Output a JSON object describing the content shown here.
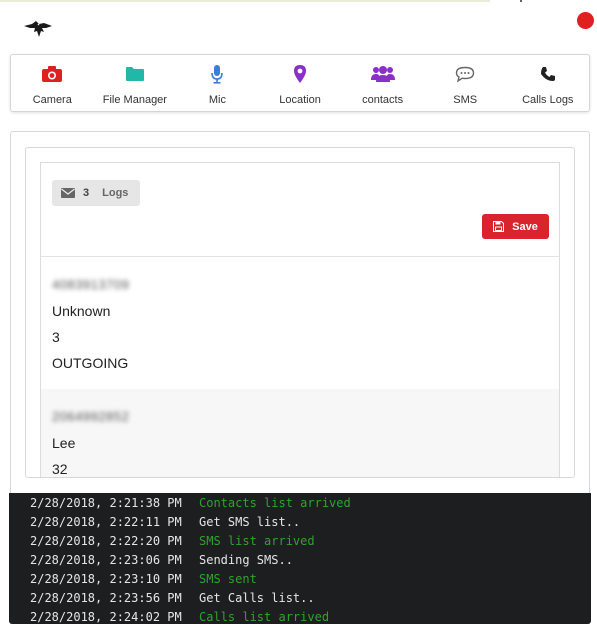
{
  "colors": {
    "accent": "#d9232d",
    "status_dot": "#e02020",
    "camera": "#e02020",
    "file_manager": "#21b8a7",
    "mic": "#3b7dd8",
    "location": "#8b2fc9",
    "contacts": "#8b2fc9",
    "sms": "#666666",
    "calls": "#222222",
    "console_bg": "#1d1e20",
    "console_green": "#32a22e"
  },
  "nav": [
    {
      "label": "Camera",
      "icon": "camera-icon"
    },
    {
      "label": "File Manager",
      "icon": "folder-icon"
    },
    {
      "label": "Mic",
      "icon": "microphone-icon"
    },
    {
      "label": "Location",
      "icon": "map-marker-icon"
    },
    {
      "label": "contacts",
      "icon": "users-icon"
    },
    {
      "label": "SMS",
      "icon": "comment-icon"
    },
    {
      "label": "Calls Logs",
      "icon": "phone-icon"
    }
  ],
  "logs": {
    "count": "3",
    "label": "Logs",
    "save_label": "Save",
    "entries": [
      {
        "number": "4083913709",
        "name": "Unknown",
        "duration": "3",
        "type": "OUTGOING"
      },
      {
        "number": "2064992852",
        "name": "Lee",
        "duration": "32",
        "type": ""
      }
    ]
  },
  "console": [
    {
      "time": "2/28/2018, 2:21:38 PM",
      "message": "Contacts list arrived",
      "color": "green"
    },
    {
      "time": "2/28/2018, 2:22:11 PM",
      "message": "Get SMS list..",
      "color": "white"
    },
    {
      "time": "2/28/2018, 2:22:20 PM",
      "message": "SMS list arrived",
      "color": "green"
    },
    {
      "time": "2/28/2018, 2:23:06 PM",
      "message": "Sending SMS..",
      "color": "white"
    },
    {
      "time": "2/28/2018, 2:23:10 PM",
      "message": "SMS sent",
      "color": "green"
    },
    {
      "time": "2/28/2018, 2:23:56 PM",
      "message": "Get Calls list..",
      "color": "white"
    },
    {
      "time": "2/28/2018, 2:24:02 PM",
      "message": "Calls list arrived",
      "color": "green"
    }
  ]
}
